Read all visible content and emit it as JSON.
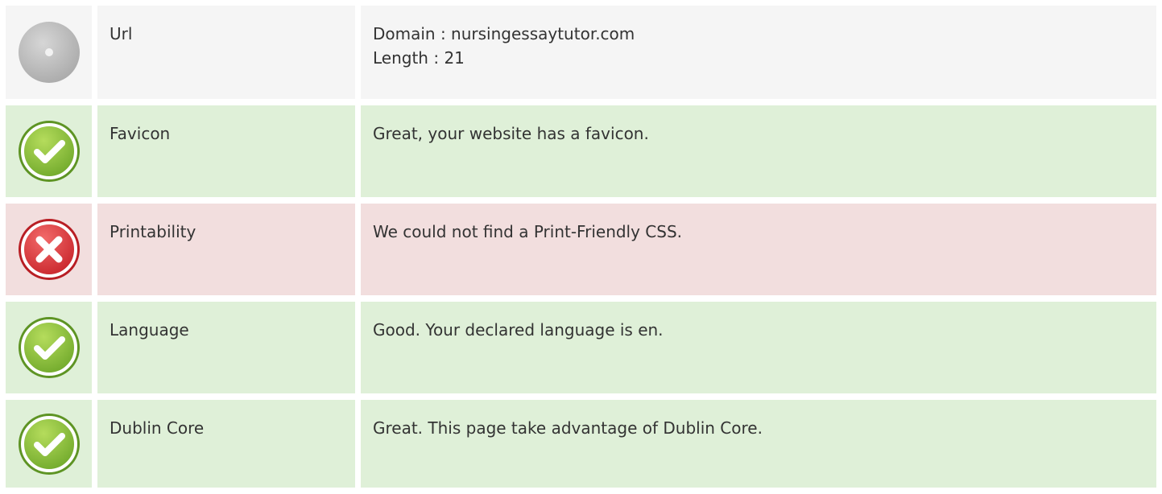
{
  "colors": {
    "neutral_bg": "#f5f5f5",
    "pass_bg": "#dff0d8",
    "fail_bg": "#f2dede",
    "pass_icon": "#8cc63f",
    "fail_icon": "#e0393e",
    "neutral_icon": "#bdbdbd"
  },
  "rows": [
    {
      "status": "neutral",
      "icon": "neutral-dot-icon",
      "label": "Url",
      "value_lines": [
        "Domain : nursingessaytutor.com",
        "Length : 21"
      ]
    },
    {
      "status": "pass",
      "icon": "check-icon",
      "label": "Favicon",
      "value_lines": [
        "Great, your website has a favicon."
      ]
    },
    {
      "status": "fail",
      "icon": "cross-icon",
      "label": "Printability",
      "value_lines": [
        "We could not find a Print-Friendly CSS."
      ]
    },
    {
      "status": "pass",
      "icon": "check-icon",
      "label": "Language",
      "value_lines": [
        "Good. Your declared language is en."
      ]
    },
    {
      "status": "pass",
      "icon": "check-icon",
      "label": "Dublin Core",
      "value_lines": [
        "Great. This page take advantage of Dublin Core."
      ]
    }
  ]
}
